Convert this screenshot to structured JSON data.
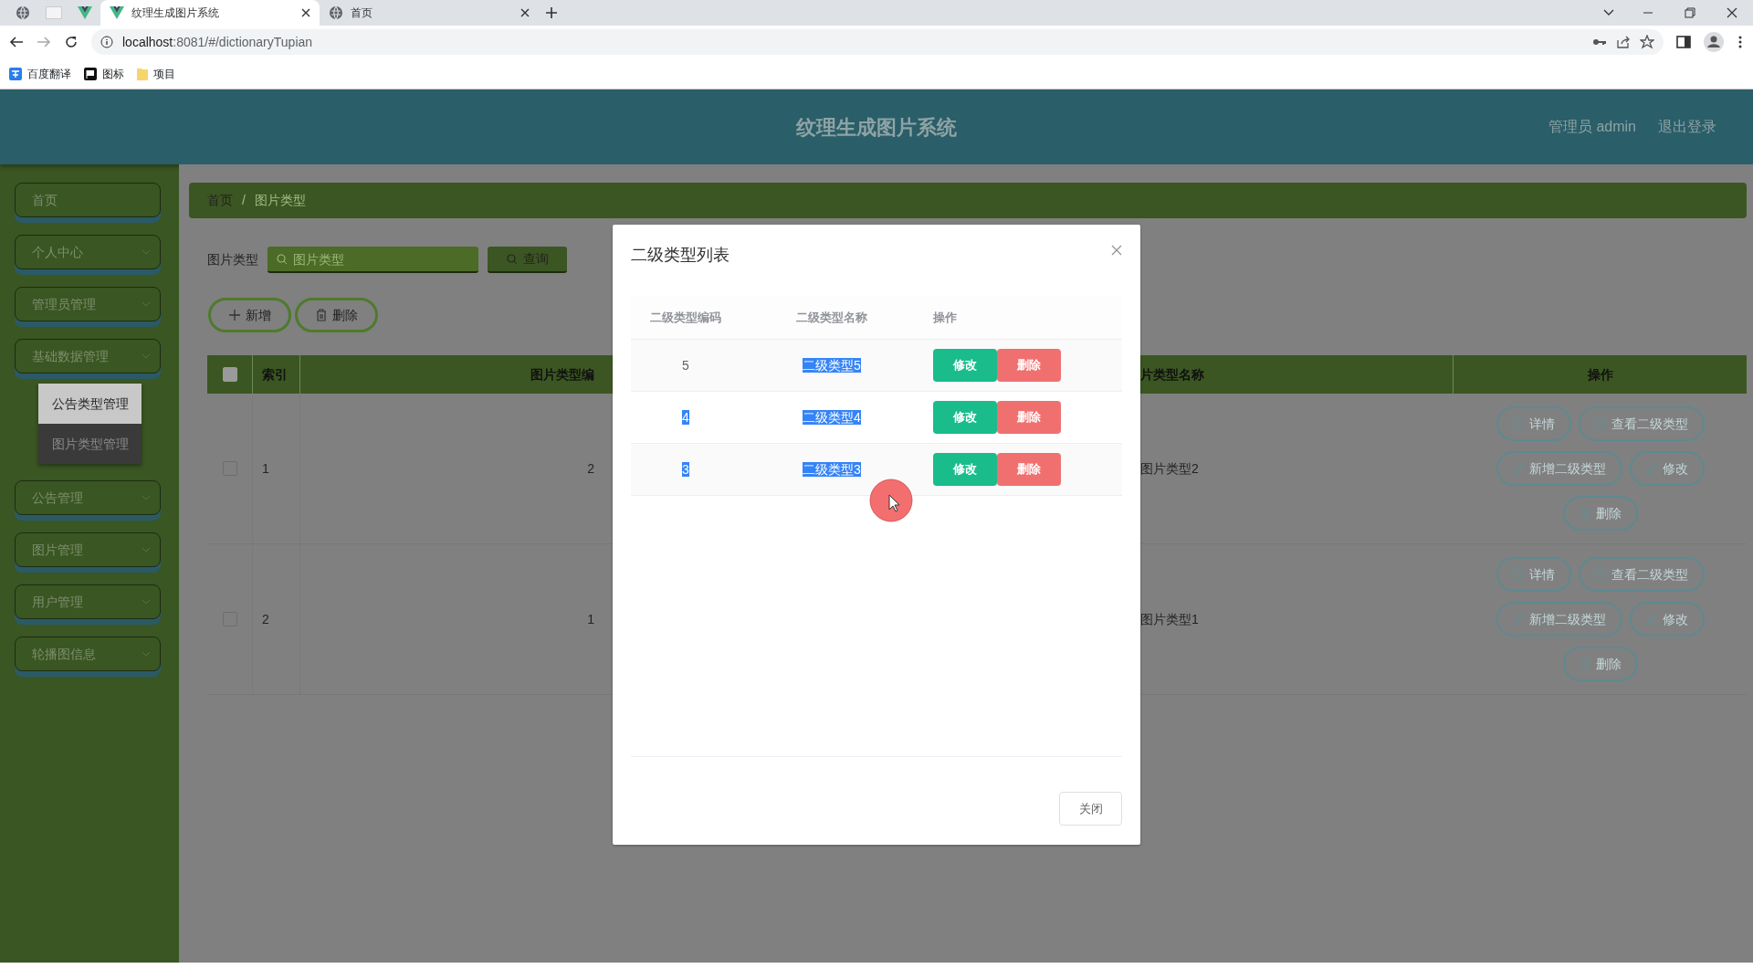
{
  "browser": {
    "tabs": [
      {
        "kind": "globe",
        "selected": false
      },
      {
        "kind": "blank",
        "selected": false
      },
      {
        "kind": "vue",
        "selected": false
      },
      {
        "kind": "vue",
        "title": "纹理生成图片系统",
        "selected": true
      },
      {
        "kind": "globe",
        "title": "首页",
        "selected": false
      }
    ],
    "url_host": "localhost",
    "url_rest": ":8081/#/dictionaryTupian",
    "bookmarks": [
      {
        "kind": "translate",
        "label": "百度翻译"
      },
      {
        "kind": "flag",
        "label": "图标"
      },
      {
        "kind": "folder",
        "label": "项目"
      }
    ]
  },
  "header": {
    "title": "纹理生成图片系统",
    "user": "管理员 admin",
    "logout": "退出登录"
  },
  "sidebar": {
    "items": [
      {
        "label": "首页",
        "kind": "link"
      },
      {
        "label": "个人中心",
        "kind": "menu"
      },
      {
        "label": "管理员管理",
        "kind": "menu"
      },
      {
        "label": "基础数据管理",
        "kind": "menu",
        "children": [
          {
            "label": "公告类型管理",
            "selected": true
          },
          {
            "label": "图片类型管理",
            "selected": false
          }
        ]
      },
      {
        "label": "公告管理",
        "kind": "menu"
      },
      {
        "label": "图片管理",
        "kind": "menu"
      },
      {
        "label": "用户管理",
        "kind": "menu"
      },
      {
        "label": "轮播图信息",
        "kind": "menu"
      }
    ]
  },
  "breadcrumb": {
    "items": [
      "首页",
      "图片类型"
    ],
    "separator": "/"
  },
  "search": {
    "label": "图片类型",
    "placeholder": "图片类型",
    "button": "查询"
  },
  "actions": [
    {
      "kind": "add",
      "label": "新增"
    },
    {
      "kind": "trash",
      "label": "删除"
    }
  ],
  "table": {
    "select_all": {
      "checked": false
    },
    "columns": [
      "索引",
      "图片类型编",
      "片类型名称",
      "操作"
    ],
    "rows": [
      {
        "checked": false,
        "index": "1",
        "code": "2",
        "name": "图片类型2",
        "buttons": [
          {
            "kind": "doc",
            "label": "详情"
          },
          {
            "kind": "doc",
            "label": "查看二级类型"
          },
          {
            "kind": "edit",
            "label": "新增二级类型"
          },
          {
            "kind": "edit",
            "label": "修改"
          },
          {
            "kind": "trash",
            "label": "删除"
          }
        ]
      },
      {
        "checked": false,
        "index": "2",
        "code": "1",
        "name": "图片类型1",
        "buttons": [
          {
            "kind": "doc",
            "label": "详情"
          },
          {
            "kind": "doc",
            "label": "查看二级类型"
          },
          {
            "kind": "edit",
            "label": "新增二级类型"
          },
          {
            "kind": "edit",
            "label": "修改"
          },
          {
            "kind": "trash",
            "label": "删除"
          }
        ]
      }
    ]
  },
  "modal": {
    "title": "二级类型列表",
    "columns": [
      "二级类型编码",
      "二级类型名称",
      "操作"
    ],
    "rows": [
      {
        "code": {
          "text": "5",
          "highlighted": false
        },
        "name": {
          "text": "二级类型5",
          "highlighted": true
        },
        "buttons": [
          "修改",
          "删除"
        ]
      },
      {
        "code": {
          "text": "4",
          "highlighted": true
        },
        "name": {
          "text": "二级类型4",
          "highlighted": true
        },
        "buttons": [
          "修改",
          "删除"
        ]
      },
      {
        "code": {
          "text": "3",
          "highlighted": true
        },
        "name": {
          "text": "二级类型3",
          "highlighted": true
        },
        "buttons": [
          "修改",
          "删除"
        ]
      }
    ],
    "close": "关闭"
  }
}
